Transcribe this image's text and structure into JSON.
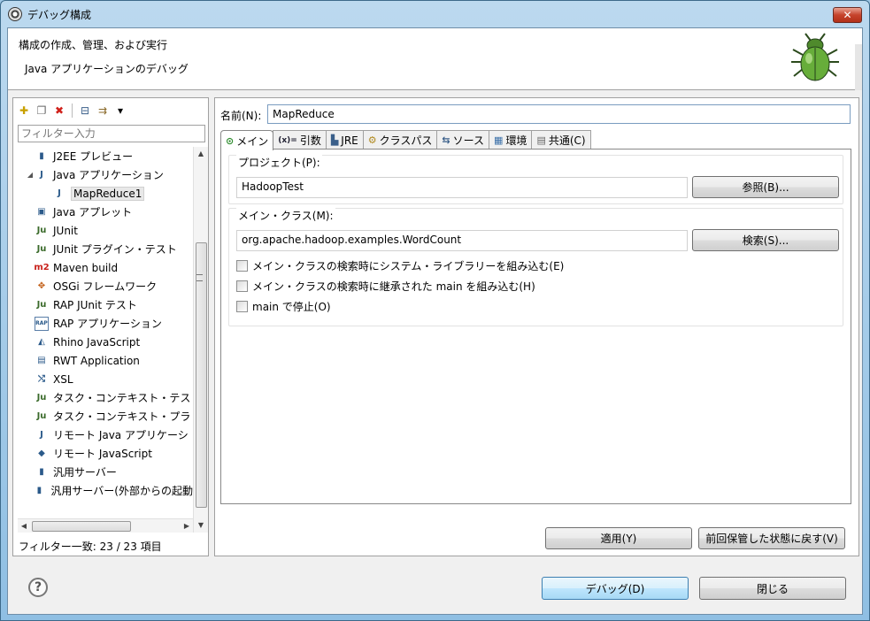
{
  "window": {
    "title": "デバッグ構成",
    "close_label": "✕"
  },
  "banner": {
    "title": "構成の作成、管理、および実行",
    "subtitle": "Java アプリケーションのデバッグ"
  },
  "left": {
    "toolbar": [
      {
        "name": "new-configuration-icon",
        "glyph": "✚"
      },
      {
        "name": "duplicate-icon",
        "glyph": "❐"
      },
      {
        "name": "delete-icon",
        "glyph": "✖"
      },
      {
        "name": "collapse-all-icon",
        "glyph": "⊟"
      },
      {
        "name": "filter-icon",
        "glyph": "⇉"
      },
      {
        "name": "view-menu-icon",
        "glyph": "▾"
      }
    ],
    "filter_placeholder": "フィルター入力",
    "tree": [
      {
        "label": "J2EE プレビュー",
        "icon": "server-icon",
        "glyph": "▮",
        "indent": 0
      },
      {
        "label": "Java アプリケーション",
        "icon": "java-app-icon",
        "glyph": "J",
        "indent": 0,
        "expanded": true
      },
      {
        "label": "MapReduce1",
        "icon": "java-app-icon",
        "glyph": "J",
        "indent": 1,
        "selected": true
      },
      {
        "label": "Java アプレット",
        "icon": "applet-icon",
        "glyph": "▣",
        "indent": 0
      },
      {
        "label": "JUnit",
        "icon": "junit-icon",
        "glyph": "Ju",
        "indent": 0
      },
      {
        "label": "JUnit プラグイン・テスト",
        "icon": "junit-plugin-icon",
        "glyph": "Ju",
        "indent": 0
      },
      {
        "label": "Maven build",
        "icon": "maven-icon",
        "glyph": "m2",
        "indent": 0
      },
      {
        "label": "OSGi フレームワーク",
        "icon": "osgi-icon",
        "glyph": "✥",
        "indent": 0
      },
      {
        "label": "RAP JUnit テスト",
        "icon": "rap-junit-icon",
        "glyph": "Ju",
        "indent": 0
      },
      {
        "label": "RAP アプリケーション",
        "icon": "rap-app-icon",
        "glyph": "RAP",
        "indent": 0
      },
      {
        "label": "Rhino JavaScript",
        "icon": "rhino-icon",
        "glyph": "◭",
        "indent": 0
      },
      {
        "label": "RWT Application",
        "icon": "rwt-app-icon",
        "glyph": "▤",
        "indent": 0
      },
      {
        "label": "XSL",
        "icon": "xsl-icon",
        "glyph": "⤭",
        "indent": 0
      },
      {
        "label": "タスク・コンテキスト・テス",
        "icon": "task-context-test-icon",
        "glyph": "Ju",
        "indent": 0
      },
      {
        "label": "タスク・コンテキスト・プラ",
        "icon": "task-context-plugin-icon",
        "glyph": "Ju",
        "indent": 0
      },
      {
        "label": "リモート Java アプリケーシ",
        "icon": "remote-java-icon",
        "glyph": "J",
        "indent": 0
      },
      {
        "label": "リモート JavaScript",
        "icon": "remote-javascript-icon",
        "glyph": "◆",
        "indent": 0
      },
      {
        "label": "汎用サーバー",
        "icon": "server-icon",
        "glyph": "▮",
        "indent": 0
      },
      {
        "label": "汎用サーバー(外部からの起動",
        "icon": "server-icon",
        "glyph": "▮",
        "indent": 0
      }
    ],
    "filter_status": "フィルター一致: 23 / 23 項目"
  },
  "right": {
    "name_label": "名前(N):",
    "name_value": "MapReduce",
    "tabs": [
      {
        "label": "メイン",
        "icon": "main-tab-icon",
        "glyph": "⊙",
        "active": true
      },
      {
        "label": "引数",
        "icon": "arguments-tab-icon",
        "glyph": "(x)="
      },
      {
        "label": "JRE",
        "icon": "jre-tab-icon",
        "glyph": "▙"
      },
      {
        "label": "クラスパス",
        "icon": "classpath-tab-icon",
        "glyph": "⚙"
      },
      {
        "label": "ソース",
        "icon": "source-tab-icon",
        "glyph": "⇆"
      },
      {
        "label": "環境",
        "icon": "environment-tab-icon",
        "glyph": "▦"
      },
      {
        "label": "共通(C)",
        "icon": "common-tab-icon",
        "glyph": "▤"
      }
    ],
    "project": {
      "label": "プロジェクト(P):",
      "value": "HadoopTest",
      "browse_label": "参照(B)..."
    },
    "main_class": {
      "label": "メイン・クラス(M):",
      "value": "org.apache.hadoop.examples.WordCount",
      "search_label": "検索(S)..."
    },
    "checkboxes": [
      {
        "label": "メイン・クラスの検索時にシステム・ライブラリーを組み込む(E)",
        "checked": false
      },
      {
        "label": "メイン・クラスの検索時に継承された main を組み込む(H)",
        "checked": false
      },
      {
        "label": "main で停止(O)",
        "checked": false
      }
    ],
    "apply_label": "適用(Y)",
    "revert_label": "前回保管した状態に戻す(V)"
  },
  "footer": {
    "help_label": "?",
    "debug_label": "デバッグ(D)",
    "close_label": "閉じる"
  }
}
